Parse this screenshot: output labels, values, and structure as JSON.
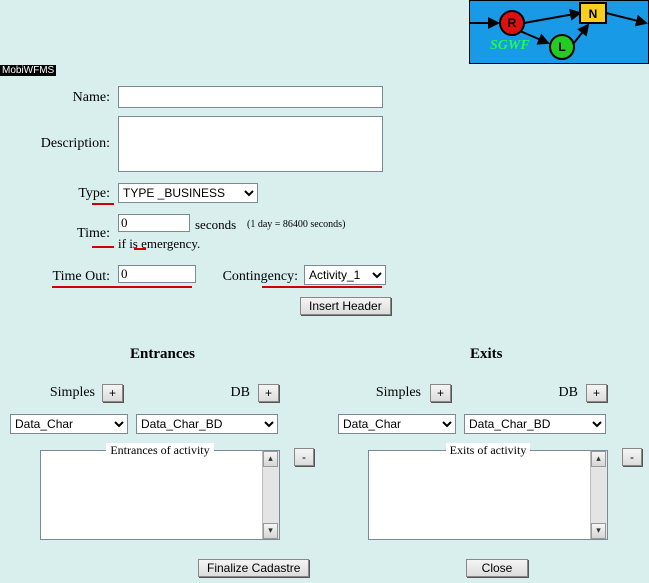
{
  "header": {
    "app": "MobiWFMS"
  },
  "form": {
    "name": {
      "label": "Name:",
      "value": ""
    },
    "description": {
      "label": "Description:",
      "value": ""
    },
    "type": {
      "label": "Type:",
      "selected": "TYPE _BUSINESS"
    },
    "time": {
      "label": "Time:",
      "value": "0",
      "unit": "seconds",
      "hint1": "(1 day = 86400 seconds)",
      "hint2": "if is emergency."
    },
    "timeout": {
      "label": "Time Out:",
      "value": "0"
    },
    "contingency": {
      "label": "Contingency:",
      "selected": "Activity_1"
    },
    "insert_header": "Insert Header"
  },
  "entrances": {
    "title": "Entrances",
    "simples": "Simples",
    "db": "DB",
    "simples_opt": "Data_Char",
    "db_opt": "Data_Char_BD",
    "box_title": "Entrances of activity"
  },
  "exits": {
    "title": "Exits",
    "simples": "Simples",
    "db": "DB",
    "simples_opt": "Data_Char",
    "db_opt": "Data_Char_BD",
    "box_title": "Exits of activity"
  },
  "common": {
    "plus": "+",
    "minus": "-"
  },
  "footer": {
    "finalize": "Finalize Cadastre",
    "close": "Close"
  }
}
